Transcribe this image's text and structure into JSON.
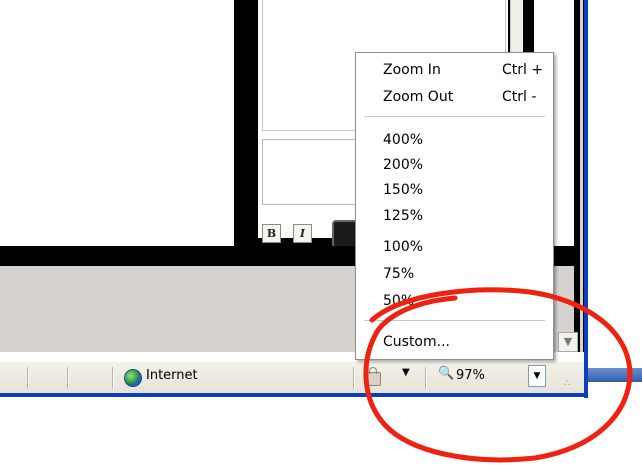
{
  "background_window": {
    "format_buttons": {
      "bold": "B",
      "italic": "I"
    }
  },
  "zoom_menu": {
    "items": [
      {
        "label": "Zoom In",
        "shortcut": "Ctrl +"
      },
      {
        "label": "Zoom Out",
        "shortcut": "Ctrl -"
      }
    ],
    "levels": [
      "400%",
      "200%",
      "150%",
      "125%",
      "100%",
      "75%",
      "50%"
    ],
    "custom_label": "Custom..."
  },
  "status_bar": {
    "zone_label": "Internet",
    "zoom_value": "97%",
    "zoom_icon": "zoom-magnifier-icon",
    "security_icon": "padlock-icon"
  },
  "colors": {
    "highlight": "#ee2211",
    "window_frame": "#0a3fbf"
  }
}
